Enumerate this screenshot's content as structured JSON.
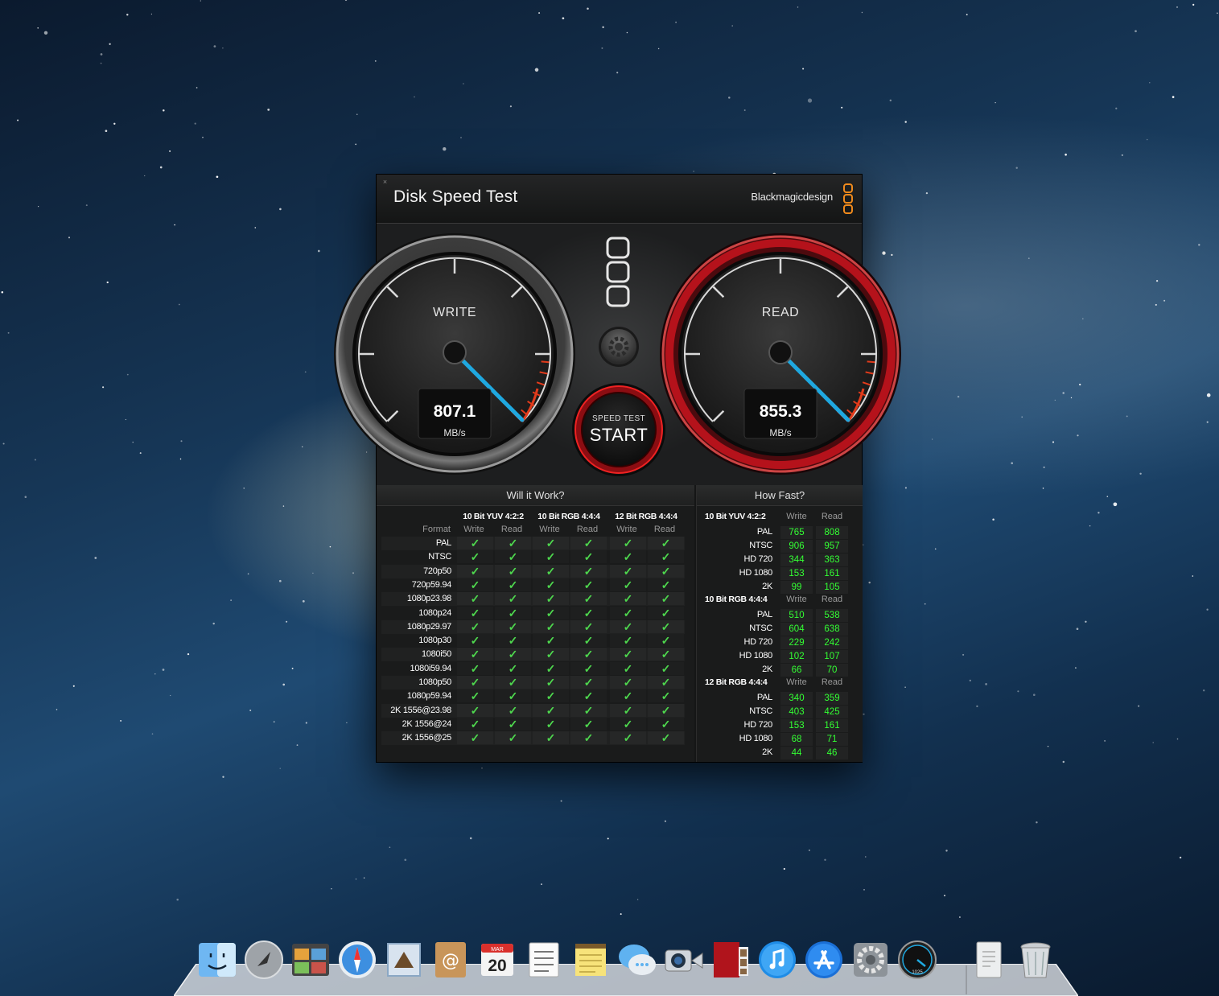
{
  "window": {
    "title": "Disk Speed Test",
    "brand": "Blackmagicdesign",
    "close_glyph": "×"
  },
  "gauges": {
    "write": {
      "label": "WRITE",
      "value": "807.1",
      "unit": "MB/s"
    },
    "read": {
      "label": "READ",
      "value": "855.3",
      "unit": "MB/s"
    }
  },
  "start_button": {
    "small_label": "SPEED TEST",
    "label": "START"
  },
  "will_it_work": {
    "title": "Will it Work?",
    "format_label": "Format",
    "groups": [
      "10 Bit YUV 4:2:2",
      "10 Bit RGB 4:4:4",
      "12 Bit RGB 4:4:4"
    ],
    "sub_labels": [
      "Write",
      "Read"
    ],
    "check_glyph": "✓",
    "formats": [
      "PAL",
      "NTSC",
      "720p50",
      "720p59.94",
      "1080p23.98",
      "1080p24",
      "1080p29.97",
      "1080p30",
      "1080i50",
      "1080i59.94",
      "1080p50",
      "1080p59.94",
      "2K 1556@23.98",
      "2K 1556@24",
      "2K 1556@25"
    ]
  },
  "how_fast": {
    "title": "How Fast?",
    "sub_labels": [
      "Write",
      "Read"
    ],
    "groups": [
      {
        "name": "10 Bit YUV 4:2:2",
        "rows": [
          {
            "format": "PAL",
            "write": "765",
            "read": "808"
          },
          {
            "format": "NTSC",
            "write": "906",
            "read": "957"
          },
          {
            "format": "HD 720",
            "write": "344",
            "read": "363"
          },
          {
            "format": "HD 1080",
            "write": "153",
            "read": "161"
          },
          {
            "format": "2K",
            "write": "99",
            "read": "105"
          }
        ]
      },
      {
        "name": "10 Bit RGB 4:4:4",
        "rows": [
          {
            "format": "PAL",
            "write": "510",
            "read": "538"
          },
          {
            "format": "NTSC",
            "write": "604",
            "read": "638"
          },
          {
            "format": "HD 720",
            "write": "229",
            "read": "242"
          },
          {
            "format": "HD 1080",
            "write": "102",
            "read": "107"
          },
          {
            "format": "2K",
            "write": "66",
            "read": "70"
          }
        ]
      },
      {
        "name": "12 Bit RGB 4:4:4",
        "rows": [
          {
            "format": "PAL",
            "write": "340",
            "read": "359"
          },
          {
            "format": "NTSC",
            "write": "403",
            "read": "425"
          },
          {
            "format": "HD 720",
            "write": "153",
            "read": "161"
          },
          {
            "format": "HD 1080",
            "write": "68",
            "read": "71"
          },
          {
            "format": "2K",
            "write": "44",
            "read": "46"
          }
        ]
      }
    ]
  },
  "dock": {
    "calendar_month": "MAR",
    "calendar_day": "20",
    "speedometer_text": "1025",
    "items": [
      "finder-icon",
      "launchpad-icon",
      "photo-browser-icon",
      "safari-icon",
      "mail-icon",
      "contacts-icon",
      "calendar-icon",
      "reminders-icon",
      "notes-icon",
      "messages-icon",
      "facetime-icon",
      "photo-booth-icon",
      "itunes-icon",
      "app-store-icon",
      "system-preferences-icon",
      "disk-speed-test-icon",
      "downloads-icon",
      "trash-icon"
    ]
  },
  "colors": {
    "value_green": "#33ff33",
    "check_green": "#4ed84e",
    "needle_blue": "#1fa8e0",
    "read_ring_red": "#b5121b",
    "brand_orange": "#f08a1c"
  }
}
